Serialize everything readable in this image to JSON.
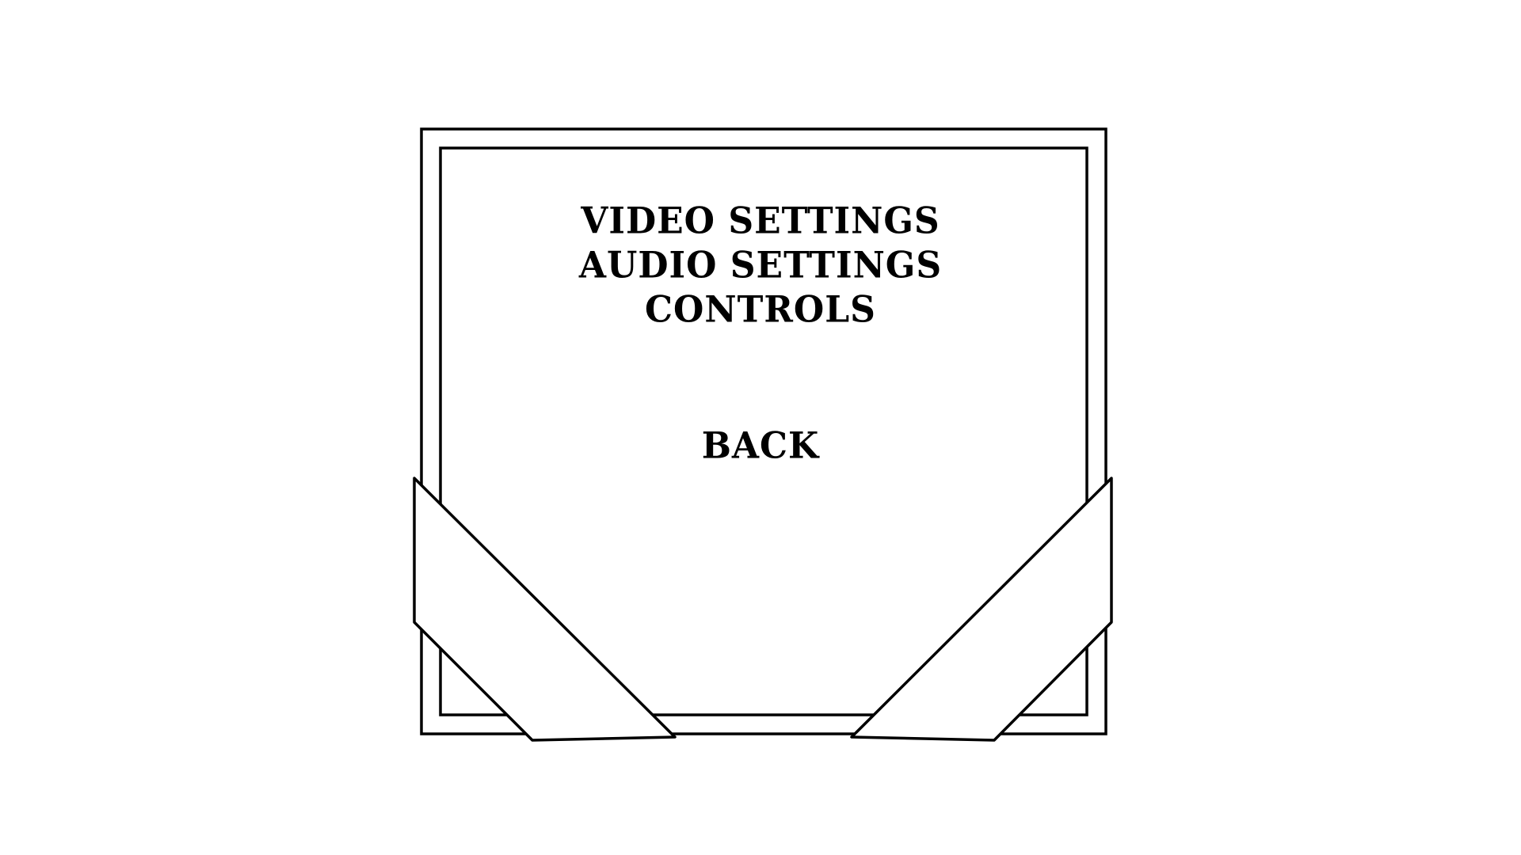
{
  "menu": {
    "items": [
      {
        "label": "VIDEO SETTINGS"
      },
      {
        "label": "AUDIO SETTINGS"
      },
      {
        "label": "CONTROLS"
      }
    ],
    "back_label": "BACK"
  },
  "colors": {
    "background": "#ffffff",
    "ink": "#000000",
    "ribbon_fill": "#ffffff"
  }
}
